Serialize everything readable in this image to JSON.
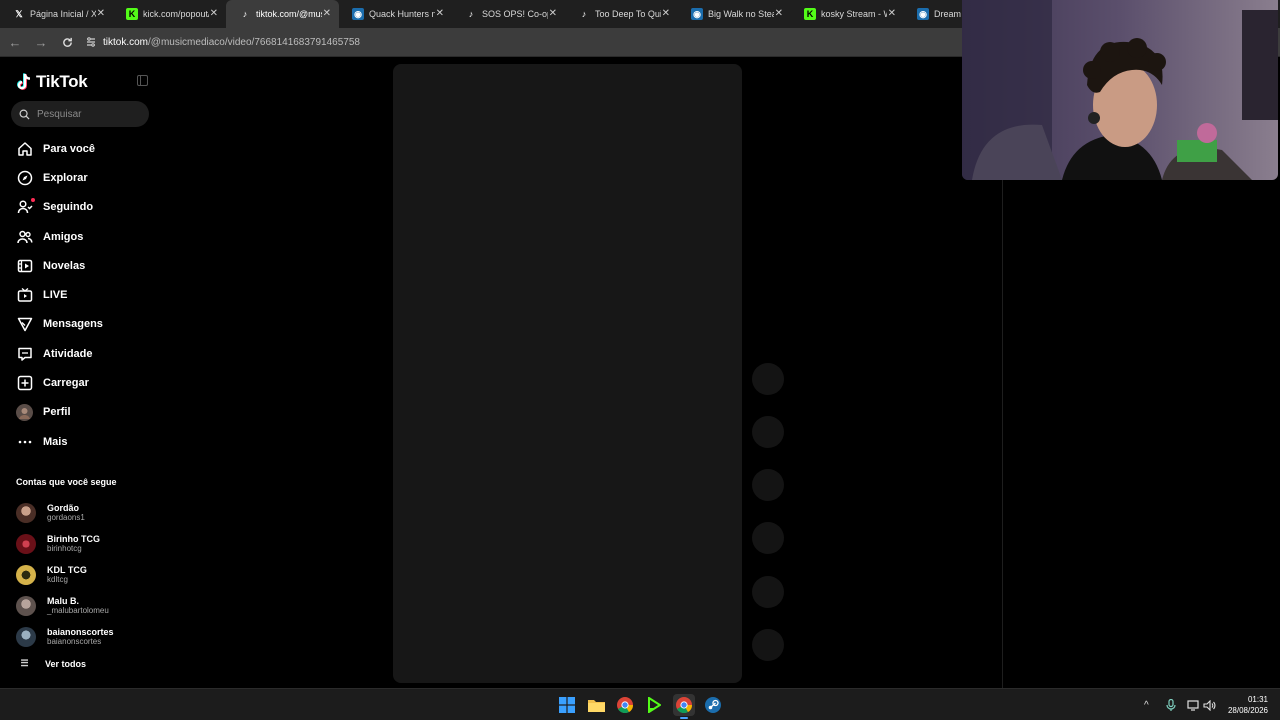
{
  "browser": {
    "tabs": [
      {
        "title": "Página Inicial / X",
        "icon": "x-logo-icon"
      },
      {
        "title": "kick.com/popout/k",
        "icon": "kick-logo-icon"
      },
      {
        "title": "tiktok.com/@music",
        "icon": "tiktok-logo-icon",
        "active": true
      },
      {
        "title": "Quack Hunters no",
        "icon": "steam-logo-icon"
      },
      {
        "title": "SOS OPS! Co-op d",
        "icon": "tiktok-logo-icon"
      },
      {
        "title": "Too Deep To Quit",
        "icon": "tiktok-logo-icon"
      },
      {
        "title": "Big Walk no Steam",
        "icon": "steam-logo-icon"
      },
      {
        "title": "kosky Stream - Wa",
        "icon": "kick-logo-icon"
      },
      {
        "title": "Dream",
        "icon": "steam-logo-icon"
      }
    ],
    "url_host": "tiktok.com",
    "url_path": "/@musicmediaco/video/7668141683791465758"
  },
  "sidebar": {
    "logo_text": "TikTok",
    "search_placeholder": "Pesquisar",
    "nav": [
      {
        "label": "Para você",
        "icon": "home-icon"
      },
      {
        "label": "Explorar",
        "icon": "compass-icon"
      },
      {
        "label": "Seguindo",
        "icon": "following-icon"
      },
      {
        "label": "Amigos",
        "icon": "friends-icon"
      },
      {
        "label": "Novelas",
        "icon": "novelas-icon"
      },
      {
        "label": "LIVE",
        "icon": "live-tv-icon"
      },
      {
        "label": "Mensagens",
        "icon": "messages-icon"
      },
      {
        "label": "Atividade",
        "icon": "activity-icon"
      },
      {
        "label": "Carregar",
        "icon": "upload-icon"
      },
      {
        "label": "Perfil",
        "icon": "profile-avatar"
      },
      {
        "label": "Mais",
        "icon": "more-icon"
      }
    ],
    "following_title": "Contas que você segue",
    "following": [
      {
        "name": "Gordão",
        "username": "gordaons1",
        "avatar_color": "#6b4a3a"
      },
      {
        "name": "Birinho TCG",
        "username": "birinhotcg",
        "avatar_color": "#8a1c24"
      },
      {
        "name": "KDL TCG",
        "username": "kdltcg",
        "avatar_color": "#c9a23a"
      },
      {
        "name": "Malu B.",
        "username": "_malubartolomeu",
        "avatar_color": "#7a6a66"
      },
      {
        "name": "baianonscortes",
        "username": "baianonscortes",
        "avatar_color": "#3a4a5a"
      }
    ],
    "see_all": "Ver todos"
  },
  "taskbar": {
    "time": "01:31",
    "date": "28/08/2026"
  }
}
